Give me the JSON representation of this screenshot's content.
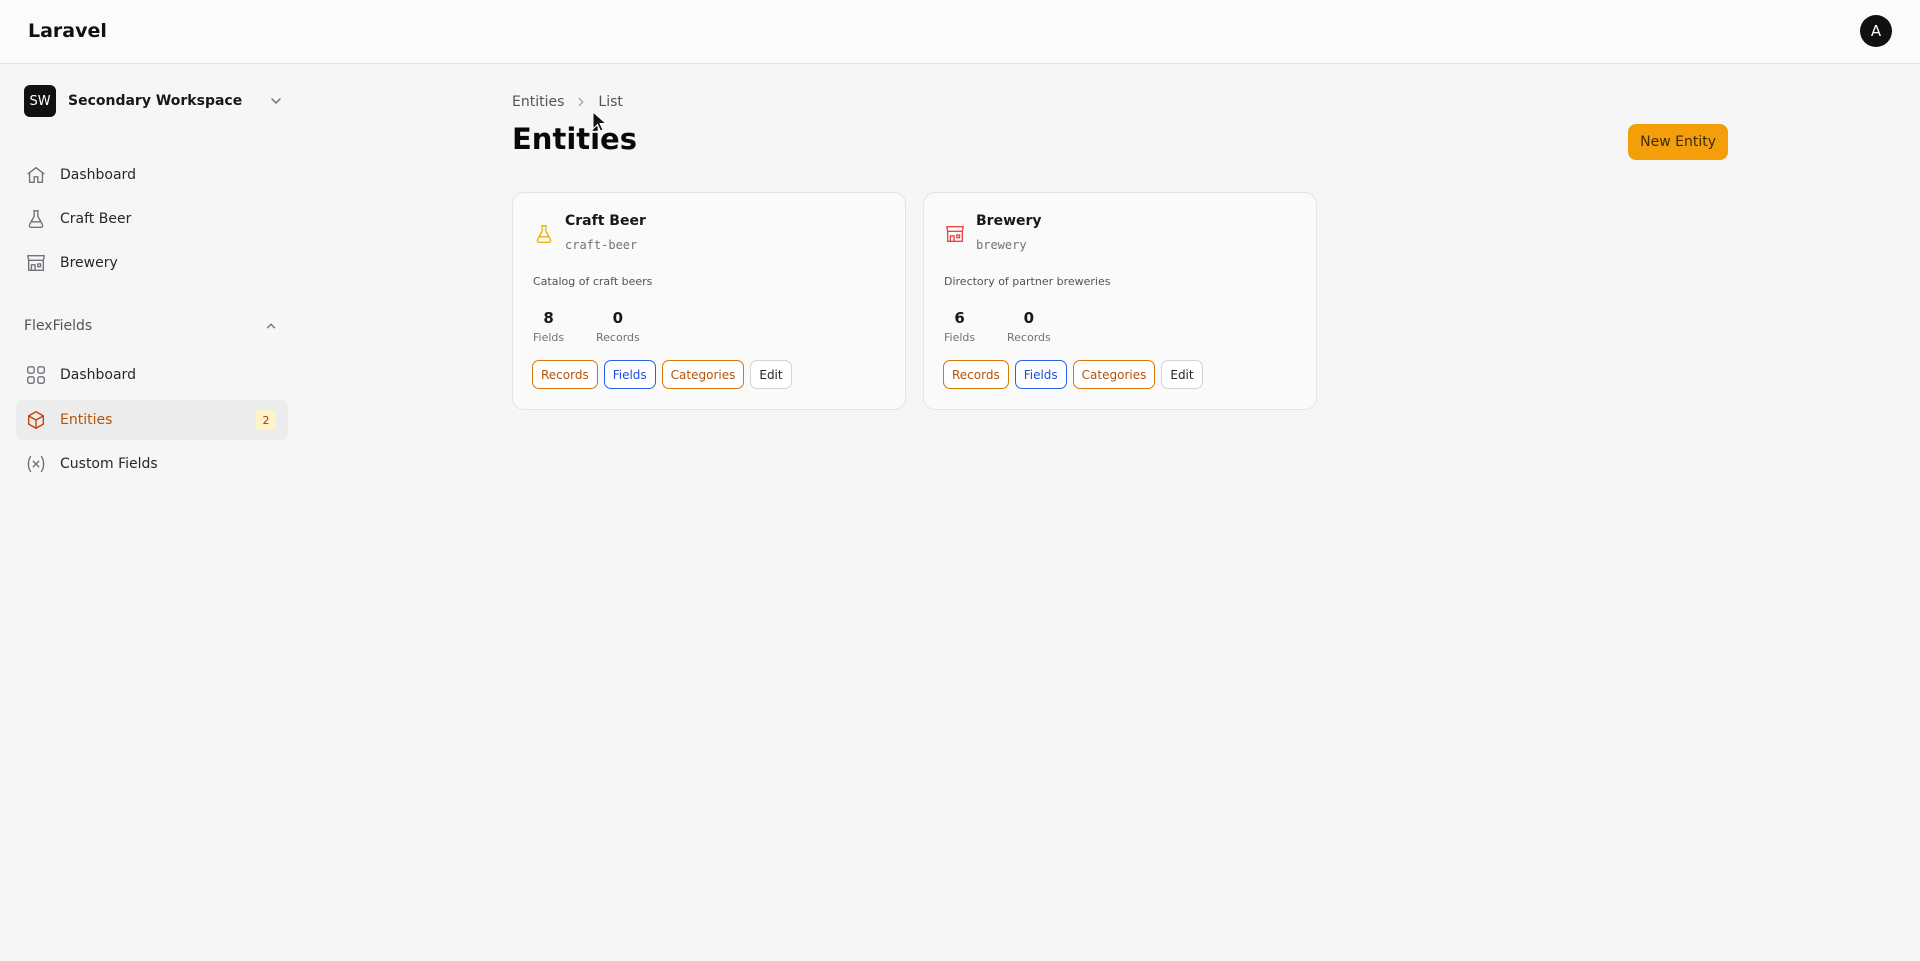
{
  "header": {
    "brand": "Laravel",
    "user_initial": "A"
  },
  "sidebar": {
    "workspace": {
      "initials": "SW",
      "name": "Secondary Workspace"
    },
    "items": [
      {
        "label": "Dashboard",
        "icon": "home-icon"
      },
      {
        "label": "Craft Beer",
        "icon": "flask-icon"
      },
      {
        "label": "Brewery",
        "icon": "building-storefront-icon"
      }
    ],
    "group": {
      "label": "FlexFields",
      "items": [
        {
          "label": "Dashboard",
          "icon": "squares-icon"
        },
        {
          "label": "Entities",
          "icon": "cube-icon",
          "badge": "2",
          "active": true
        },
        {
          "label": "Custom Fields",
          "icon": "variable-icon"
        }
      ]
    }
  },
  "breadcrumb": {
    "root": "Entities",
    "current": "List"
  },
  "page": {
    "title": "Entities",
    "new_button": "New Entity"
  },
  "colors": {
    "accent": "#f59e0b",
    "active_text": "#b45309",
    "link_blue": "#1d4ed8"
  },
  "entities": [
    {
      "name": "Craft Beer",
      "slug": "craft-beer",
      "description": "Catalog of craft beers",
      "fields_count": "8",
      "fields_caption": "Fields",
      "records_count": "0",
      "records_caption": "Records",
      "actions": {
        "records": "Records",
        "fields": "Fields",
        "categories": "Categories",
        "edit": "Edit"
      },
      "icon": "flask-icon",
      "icon_color": "#eab308"
    },
    {
      "name": "Brewery",
      "slug": "brewery",
      "description": "Directory of partner breweries",
      "fields_count": "6",
      "fields_caption": "Fields",
      "records_count": "0",
      "records_caption": "Records",
      "actions": {
        "records": "Records",
        "fields": "Fields",
        "categories": "Categories",
        "edit": "Edit"
      },
      "icon": "building-storefront-icon",
      "icon_color": "#ef4444"
    }
  ]
}
